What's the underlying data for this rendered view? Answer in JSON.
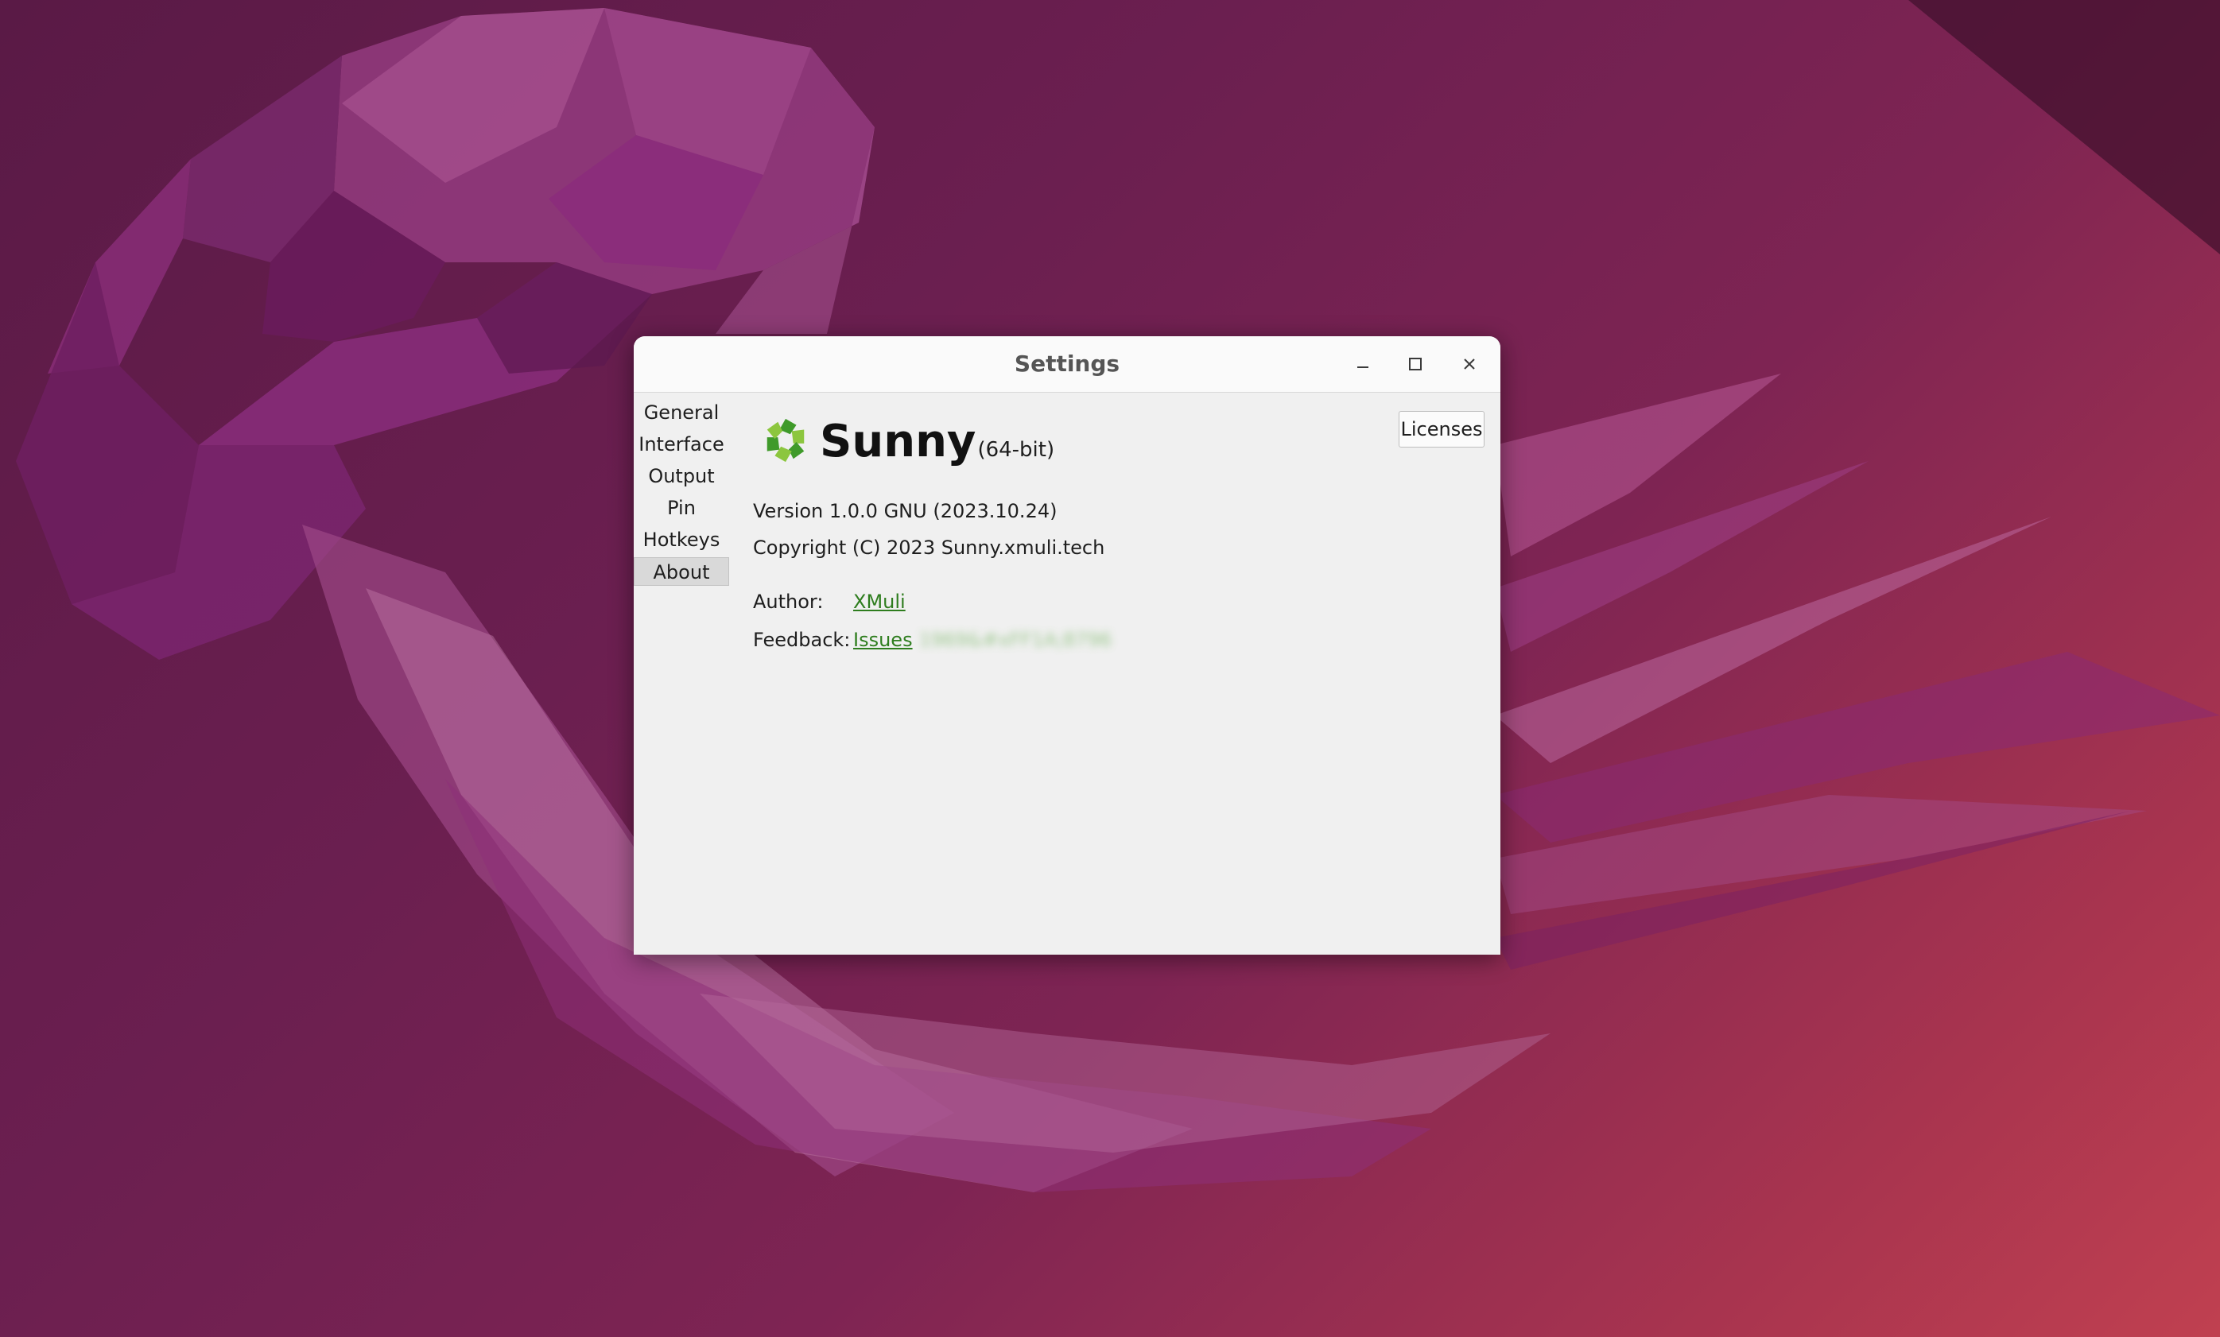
{
  "window": {
    "title": "Settings"
  },
  "sidebar": {
    "items": [
      {
        "label": "General"
      },
      {
        "label": "Interface"
      },
      {
        "label": "Output"
      },
      {
        "label": "Pin"
      },
      {
        "label": "Hotkeys"
      },
      {
        "label": "About",
        "active": true
      }
    ]
  },
  "about": {
    "app_name": "Sunny",
    "architecture": "(64-bit)",
    "version": "Version 1.0.0 GNU (2023.10.24)",
    "copyright": "Copyright (C) 2023 Sunny.xmuli.tech",
    "author_label": "Author:",
    "author_link": "XMuli",
    "feedback_label": "Feedback:",
    "feedback_link": "Issues",
    "feedback_extra": "1969&#xFF1A;8796",
    "licenses_button": "Licenses"
  },
  "colors": {
    "link": "#2e7d1e",
    "logo_green_dark": "#3f9a2a",
    "logo_green_light": "#8cc63e"
  },
  "icons": {
    "minimize": "minimize-icon",
    "maximize": "maximize-icon",
    "close": "close-icon",
    "logo": "sunny-logo-icon"
  }
}
